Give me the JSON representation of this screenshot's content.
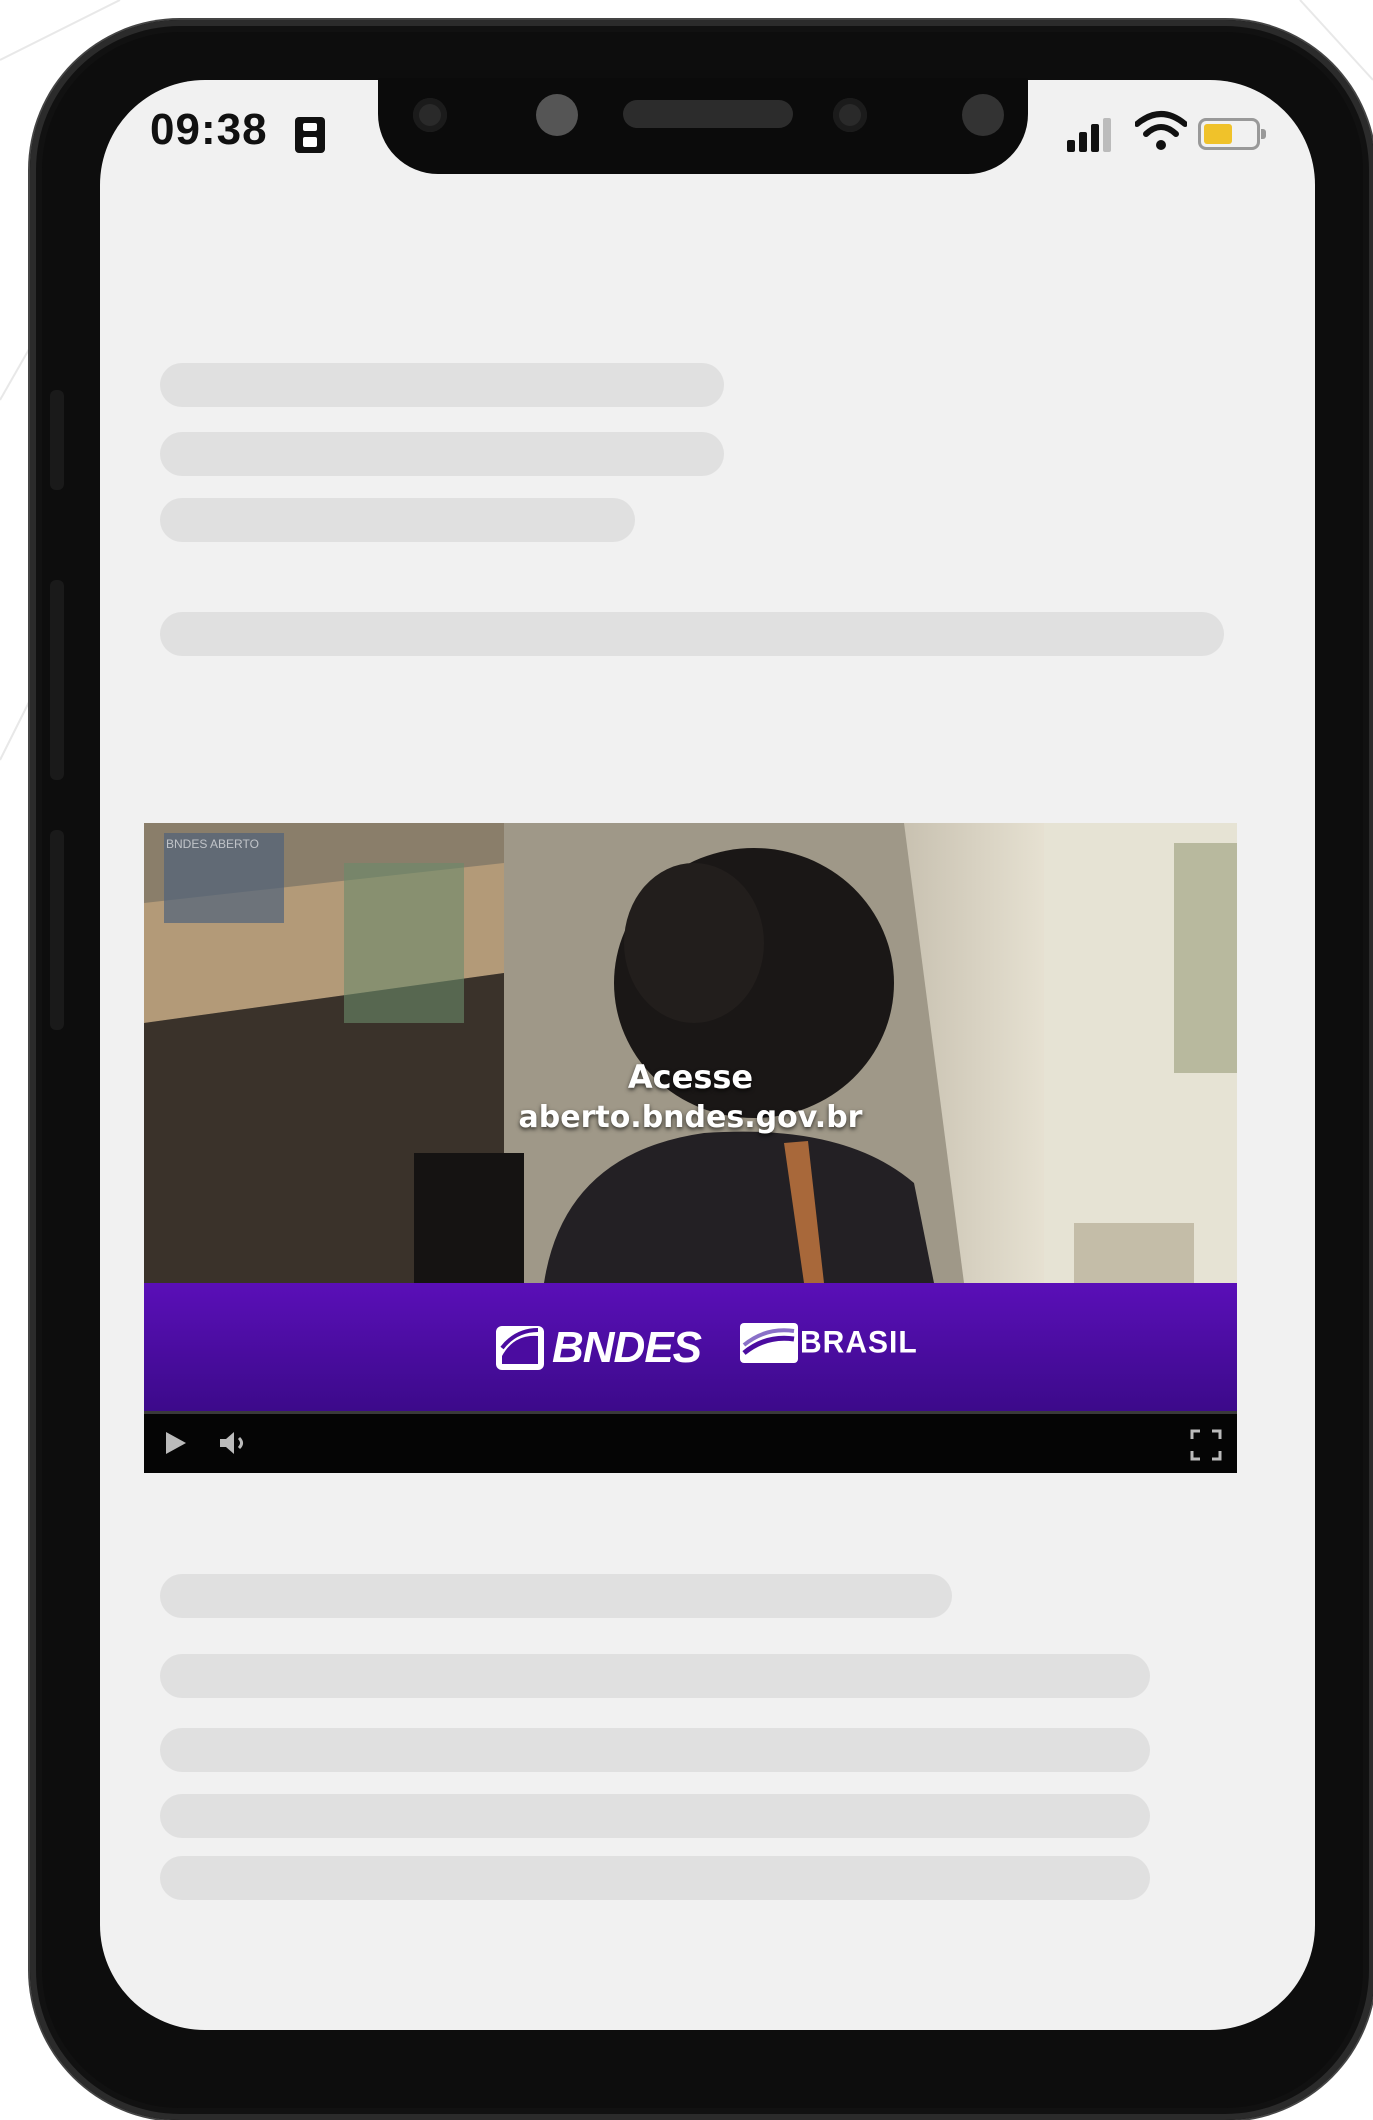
{
  "status_bar": {
    "time": "09:38"
  },
  "video": {
    "watermark": "BNDES ABERTO",
    "caption_line1": "Acesse",
    "caption_line2": "aberto.bndes.gov.br",
    "brand": "BNDES",
    "government_brand": "BRASIL"
  },
  "icons": [
    "sim-card-icon",
    "signal-icon",
    "wifi-icon",
    "battery-icon",
    "play-icon",
    "volume-icon",
    "fullscreen-icon"
  ],
  "colors": {
    "screen_bg": "#f1f1f1",
    "skeleton": "#e0e0e0",
    "bndes_purple": "#4b0ca0",
    "battery": "#f0c22a"
  }
}
